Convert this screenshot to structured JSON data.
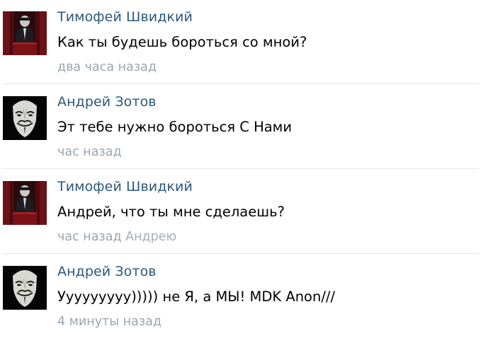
{
  "comments": [
    {
      "author": "Тимофей Швидкий",
      "avatar_icon": "podium-figure-avatar",
      "text": "Как ты будешь бороться со мной?",
      "time": "два часа назад",
      "reply_to": ""
    },
    {
      "author": "Андрей Зотов",
      "avatar_icon": "guy-fawkes-mask-avatar",
      "text": "Эт тебе нужно бороться С Нами",
      "time": "час назад",
      "reply_to": ""
    },
    {
      "author": "Тимофей Швидкий",
      "avatar_icon": "podium-figure-avatar",
      "text": "Андрей, что ты мне сделаешь?",
      "time": "час назад",
      "reply_to": "Андрею"
    },
    {
      "author": "Андрей Зотов",
      "avatar_icon": "guy-fawkes-mask-avatar",
      "text": "Ууууууууу))))) не Я, а МЫ! MDK Anon///",
      "time": "4 минуты назад",
      "reply_to": ""
    }
  ],
  "colors": {
    "author_link": "#2b587a",
    "meta_text": "#9ba5ad",
    "separator": "#e4e7ea"
  }
}
